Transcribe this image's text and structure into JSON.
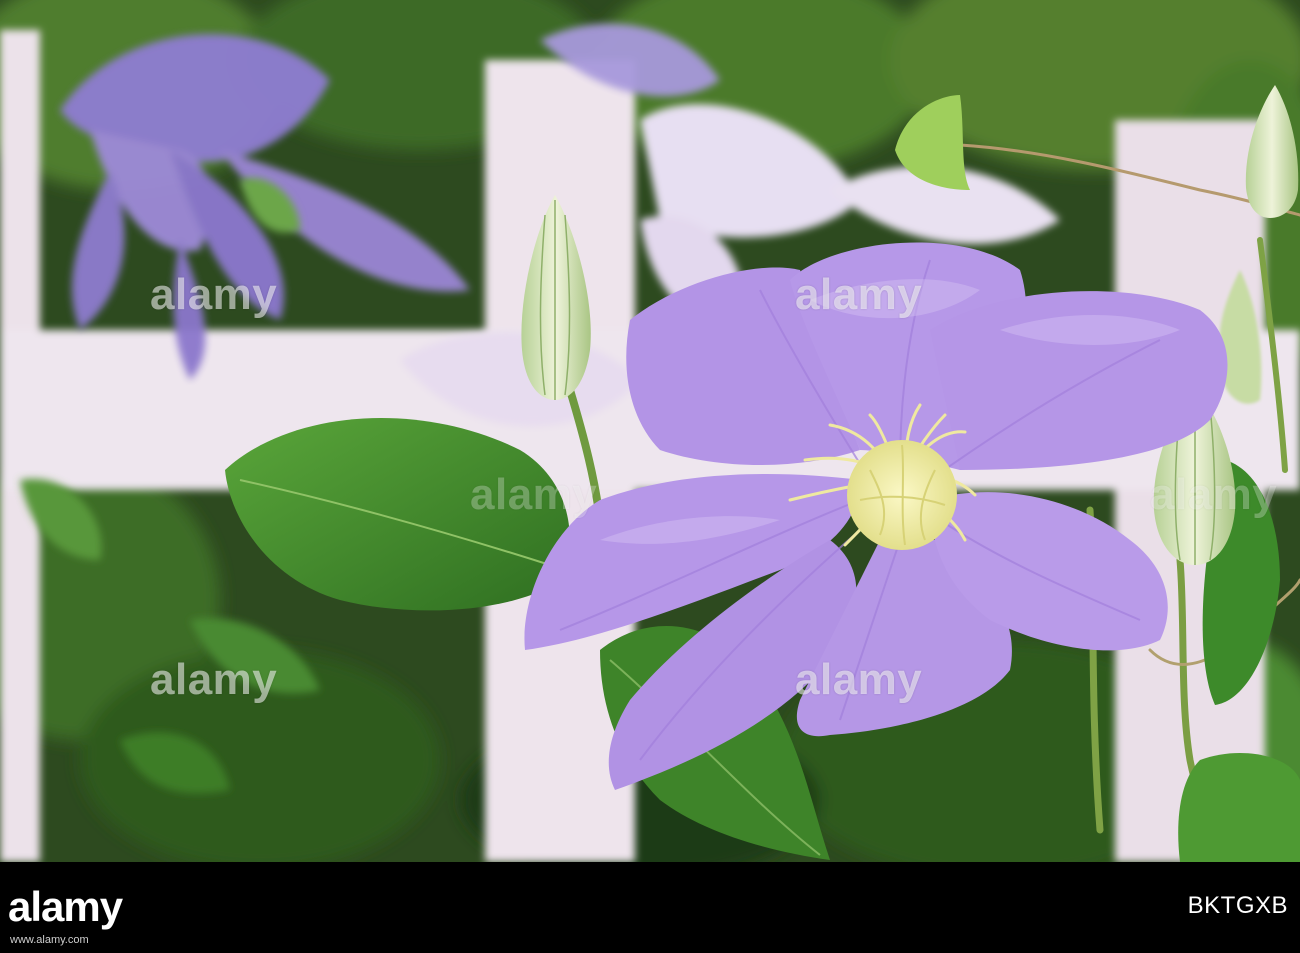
{
  "watermarks": [
    "alamy",
    "alamy",
    "alamy",
    "alamy",
    "alamy",
    "alamy"
  ],
  "footer": {
    "logo": "alamy",
    "image_id": "BKTGXB",
    "site": "www.alamy.com"
  },
  "colors": {
    "petal": "#b79be8",
    "petal_dark": "#9a7fd6",
    "stamen": "#f1eea0",
    "leaf": "#3f8a2a",
    "fence": "#efe6ee",
    "background_foliage": "#2f4a22"
  },
  "subject": "purple-clematis-flower"
}
